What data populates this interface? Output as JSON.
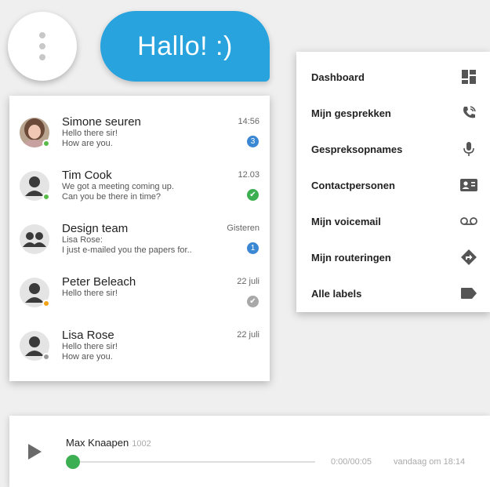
{
  "bubble": {
    "text": "Hallo! :)"
  },
  "chats": [
    {
      "name": "Simone seuren",
      "line1": "Hello there sir!",
      "line2": "How are you.",
      "time": "14:56",
      "badge": "3",
      "badge_color": "#3a87d4",
      "status_color": "#58bb4a",
      "avatar": "photo"
    },
    {
      "name": "Tim Cook",
      "line1": "We got a meeting coming up.",
      "line2": "Can you be there in time?",
      "time": "12.03",
      "badge": "✔",
      "badge_color": "#3daf53",
      "status_color": "#58bb4a",
      "avatar": "person"
    },
    {
      "name": "Design team",
      "line1": "Lisa Rose:",
      "line2": "I just e-mailed you the papers for..",
      "time": "Gisteren",
      "badge": "1",
      "badge_color": "#3a87d4",
      "status_color": "",
      "avatar": "group"
    },
    {
      "name": "Peter Beleach",
      "line1": "Hello there sir!",
      "line2": "",
      "time": "22 juli",
      "badge": "✔",
      "badge_color": "#a8a8a8",
      "status_color": "#f2a217",
      "avatar": "person"
    },
    {
      "name": "Lisa Rose",
      "line1": "Hello there sir!",
      "line2": "How are you.",
      "time": "22 juli",
      "badge": "",
      "badge_color": "",
      "status_color": "#9a9a9a",
      "avatar": "person"
    }
  ],
  "menu": [
    {
      "label": "Dashboard",
      "icon": "dashboard-icon"
    },
    {
      "label": "Mijn gesprekken",
      "icon": "phone-call-icon"
    },
    {
      "label": "Gespreksopnames",
      "icon": "microphone-icon"
    },
    {
      "label": "Contactpersonen",
      "icon": "contact-card-icon"
    },
    {
      "label": "Mijn voicemail",
      "icon": "voicemail-icon"
    },
    {
      "label": "Mijn routeringen",
      "icon": "directions-icon"
    },
    {
      "label": "Alle labels",
      "icon": "label-icon"
    }
  ],
  "player": {
    "name": "Max Knaapen",
    "extension": "1002",
    "duration": "0:00/00:05",
    "date": "vandaag om 18:14",
    "progress": 0.0
  },
  "colors": {
    "accent_blue": "#29a3dd",
    "online_green": "#58bb4a",
    "player_green": "#3daf53"
  }
}
